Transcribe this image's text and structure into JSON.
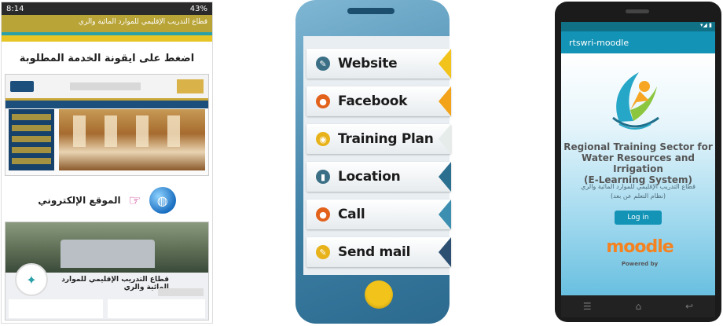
{
  "panel1": {
    "status_time": "8:14",
    "status_battery": "43%",
    "header_title": "قطاع التدريب الإقليمي للموارد المائية والري",
    "instruction": "اضغط على ايقونة الخدمة المطلوبة",
    "website_label": "الموقع الإلكتروني",
    "fb_page_name": "قطاع التدريب الإقليمي للموارد المائية والري"
  },
  "panel2": {
    "menu": [
      {
        "label": "Website",
        "icon": "website-icon",
        "icon_color": "#3a6f86",
        "tri_color": "#f2c31a"
      },
      {
        "label": "Facebook",
        "icon": "facebook-icon",
        "icon_color": "#e2621b",
        "tri_color": "#f2a31a"
      },
      {
        "label": "Training Plan",
        "icon": "training-plan-icon",
        "icon_color": "#e8b21a",
        "tri_color": "#e5ece9"
      },
      {
        "label": "Location",
        "icon": "location-icon",
        "icon_color": "#3a6f86",
        "tri_color": "#2a6f8f"
      },
      {
        "label": "Call",
        "icon": "call-icon",
        "icon_color": "#e2621b",
        "tri_color": "#3c8fb0"
      },
      {
        "label": "Send mail",
        "icon": "send-mail-icon",
        "icon_color": "#e8b21a",
        "tri_color": "#2c4f72"
      }
    ],
    "colors": {
      "case": "#3c7ea4",
      "home": "#f2c31a"
    }
  },
  "panel3": {
    "app_bar_title": "rtswri-moodle",
    "title_lines": [
      "Regional Training Sector for",
      "Water Resources and Irrigation",
      "(E-Learning System)"
    ],
    "arabic_lines": [
      "قطاع التدريب الإقليمي للموارد المائية والري",
      "(نظام التعلم عن بعد)"
    ],
    "login_label": "Log in",
    "brand": "moodle",
    "powered_by": "Powered by",
    "colors": {
      "accent": "#1393b6",
      "moodle_orange": "#f58220"
    }
  }
}
